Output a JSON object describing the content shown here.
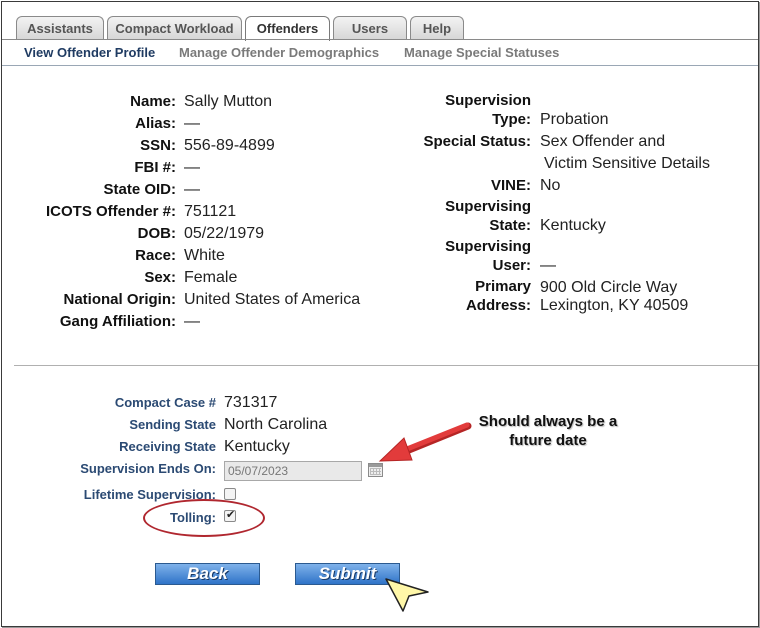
{
  "tabs": [
    {
      "label": "Assistants",
      "active": false
    },
    {
      "label": "Compact Workload",
      "active": false
    },
    {
      "label": "Offenders",
      "active": true
    },
    {
      "label": "Users",
      "active": false
    },
    {
      "label": "Help",
      "active": false
    }
  ],
  "subnav": [
    {
      "label": "View Offender Profile",
      "active": true
    },
    {
      "label": "Manage Offender Demographics",
      "active": false
    },
    {
      "label": "Manage Special Statuses",
      "active": false
    }
  ],
  "profile": {
    "name_label": "Name:",
    "name": "Sally Mutton",
    "alias_label": "Alias:",
    "alias": "—",
    "ssn_label": "SSN:",
    "ssn": "556-89-4899",
    "fbi_label": "FBI #:",
    "fbi": "—",
    "state_oid_label": "State OID:",
    "state_oid": "—",
    "icots_label": "ICOTS Offender #:",
    "icots": "751121",
    "dob_label": "DOB:",
    "dob": "05/22/1979",
    "race_label": "Race:",
    "race": "White",
    "sex_label": "Sex:",
    "sex": "Female",
    "origin_label": "National Origin:",
    "origin": "United States of America",
    "gang_label": "Gang Affiliation:",
    "gang": "—"
  },
  "supervision": {
    "type_label_1": "Supervision",
    "type_label_2": "Type:",
    "type": "Probation",
    "special_label": "Special Status:",
    "special_1": "Sex Offender and",
    "special_2": "Victim Sensitive Details",
    "vine_label": "VINE:",
    "vine": "No",
    "state_label_1": "Supervising",
    "state_label_2": "State:",
    "state": "Kentucky",
    "user_label_1": "Supervising",
    "user_label_2": "User:",
    "user": "—",
    "address_label_1": "Primary",
    "address_label_2": "Address:",
    "address_1": "900 Old Circle Way",
    "address_2": "Lexington, KY 40509"
  },
  "compact": {
    "case_label": "Compact Case #",
    "case": "731317",
    "sending_label": "Sending State",
    "sending": "North Carolina",
    "receiving_label": "Receiving State",
    "receiving": "Kentucky",
    "ends_label": "Supervision Ends On:",
    "ends_value": "05/07/2023",
    "lifetime_label": "Lifetime Supervision:",
    "lifetime_checked": false,
    "tolling_label": "Tolling:",
    "tolling_checked": true
  },
  "buttons": {
    "back": "Back",
    "submit": "Submit"
  },
  "annotation": {
    "line1": "Should always be a",
    "line2": "future date"
  },
  "colors": {
    "accent": "#2b4a73",
    "button": "#2f73c8",
    "arrow": "#e23b3b",
    "circle": "#b0272f"
  }
}
